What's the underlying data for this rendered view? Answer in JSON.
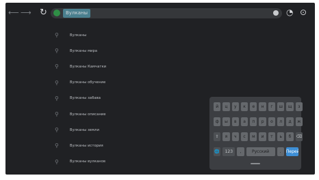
{
  "browser": {
    "back_icon": "back-arrow-icon",
    "forward_icon": "forward-arrow-icon",
    "reload_icon": "reload-icon",
    "search_query": "Вулканы",
    "share_icon": "share-icon",
    "menu_icon": "menu-icon"
  },
  "suggestions": [
    "Вулканы",
    "Вулканы мира",
    "Вулканы Камчатки",
    "Вулканы обучение",
    "Вулканы забава",
    "Вулканы описание",
    "Вулканы земли",
    "Вулканы история",
    "Вулканы вулканов"
  ],
  "keyboard": {
    "row1": [
      "й",
      "ц",
      "у",
      "к",
      "е",
      "н",
      "г",
      "ш",
      "щ",
      "з"
    ],
    "row2": [
      "ф",
      "ы",
      "в",
      "а",
      "п",
      "р",
      "о",
      "л",
      "д",
      "ж"
    ],
    "row3": [
      "⇧",
      "я",
      "ч",
      "с",
      "м",
      "и",
      "т",
      "ь",
      "б",
      "⌫"
    ],
    "row4": {
      "globe": "🌐",
      "sym": "123",
      "comma": ",",
      "space": "Русский",
      "period": ".",
      "enter": "Перейти"
    },
    "colors": {
      "key": "#65686c",
      "panel": "#3c3e42",
      "enter": "#3e8fd6"
    }
  }
}
